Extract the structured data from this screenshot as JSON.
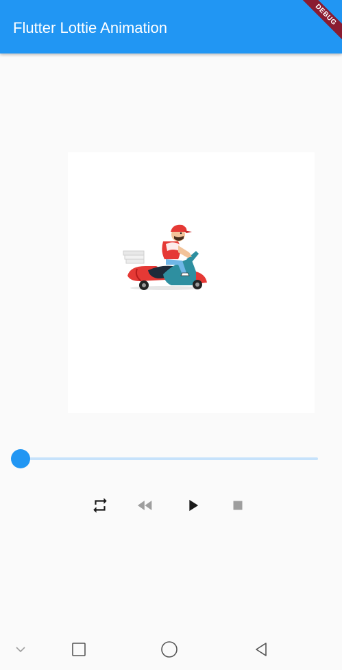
{
  "app_bar": {
    "title": "Flutter Lottie Animation",
    "background_color": "#2196f3"
  },
  "debug_banner": {
    "label": "DEBUG",
    "color": "#8a1c31"
  },
  "animation": {
    "icon": "delivery-scooter-rider-illustration"
  },
  "progress": {
    "value": 0,
    "accent_color": "#2196f3",
    "track_color": "#c6e2fb"
  },
  "controls": [
    {
      "name": "loop-button",
      "icon": "repeat-icon"
    },
    {
      "name": "rewind-button",
      "icon": "fast-rewind-icon"
    },
    {
      "name": "play-button",
      "icon": "play-icon"
    },
    {
      "name": "stop-button",
      "icon": "stop-icon"
    }
  ],
  "system_nav": [
    {
      "name": "nav-collapse-button",
      "icon": "chevron-down-icon"
    },
    {
      "name": "nav-recents-button",
      "icon": "square-icon"
    },
    {
      "name": "nav-home-button",
      "icon": "circle-icon"
    },
    {
      "name": "nav-back-button",
      "icon": "triangle-back-icon"
    }
  ]
}
